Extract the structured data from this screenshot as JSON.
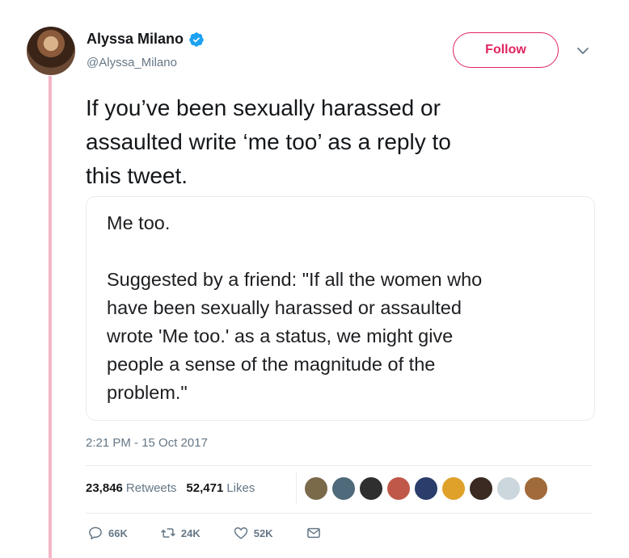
{
  "author": {
    "display_name": "Alyssa Milano",
    "handle": "@Alyssa_Milano",
    "verified_icon": "verified-badge-icon"
  },
  "follow_label": "Follow",
  "tweet_text": "If you’ve been sexually harassed or\nassaulted write ‘me too’ as a reply to\nthis tweet.",
  "image_text": "Me too.\n\nSuggested by a friend: \"If all the women who\nhave been sexually harassed or assaulted\nwrote 'Me too.' as a status, we might give\npeople a sense of the magnitude of the\nproblem.\"",
  "timestamp": "2:21 PM - 15 Oct 2017",
  "stats": {
    "retweets_count": "23,846",
    "retweets_label": "Retweets",
    "likes_count": "52,471",
    "likes_label": "Likes"
  },
  "likers": [
    "#7a6a4a",
    "#4f6a7a",
    "#2f2f2f",
    "#c0584a",
    "#2a3d6b",
    "#e0a12a",
    "#3a2a22",
    "#ccd6dd",
    "#a06a3a"
  ],
  "actions": {
    "reply_count": "66K",
    "retweet_count": "24K",
    "like_count": "52K"
  },
  "colors": {
    "accent": "#e0245e",
    "verified": "#1da1f2",
    "thread_line": "#f4b6c8"
  }
}
